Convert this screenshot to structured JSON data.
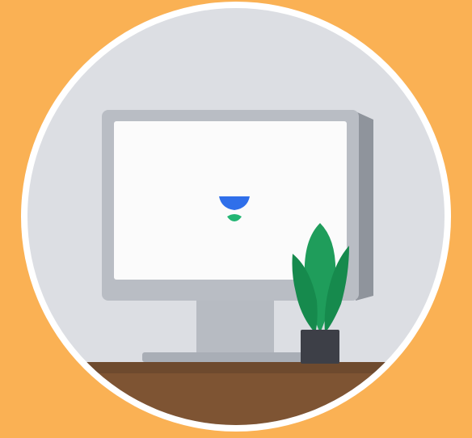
{
  "palette": {
    "background": "#FAB154",
    "circle_ring": "#FFFFFF",
    "circle_fill": "#DCDEE3",
    "monitor_bezel": "#B9BDC4",
    "monitor_bezel_side": "#8F949C",
    "screen": "#FBFBFB",
    "stand": "#B7BBC2",
    "stand_base": "#A9AEB6",
    "desk_top": "#6E4A2E",
    "desk_front": "#7E5433",
    "plant_leaf": "#1F9D5B",
    "plant_leaf_dark": "#168A4D",
    "pot": "#3D3F47",
    "logo_top": "#2F6FEA",
    "logo_bottom": "#22B573"
  },
  "icons": {
    "screen_logo": "cup-logo-icon",
    "plant": "potted-plant-icon"
  }
}
